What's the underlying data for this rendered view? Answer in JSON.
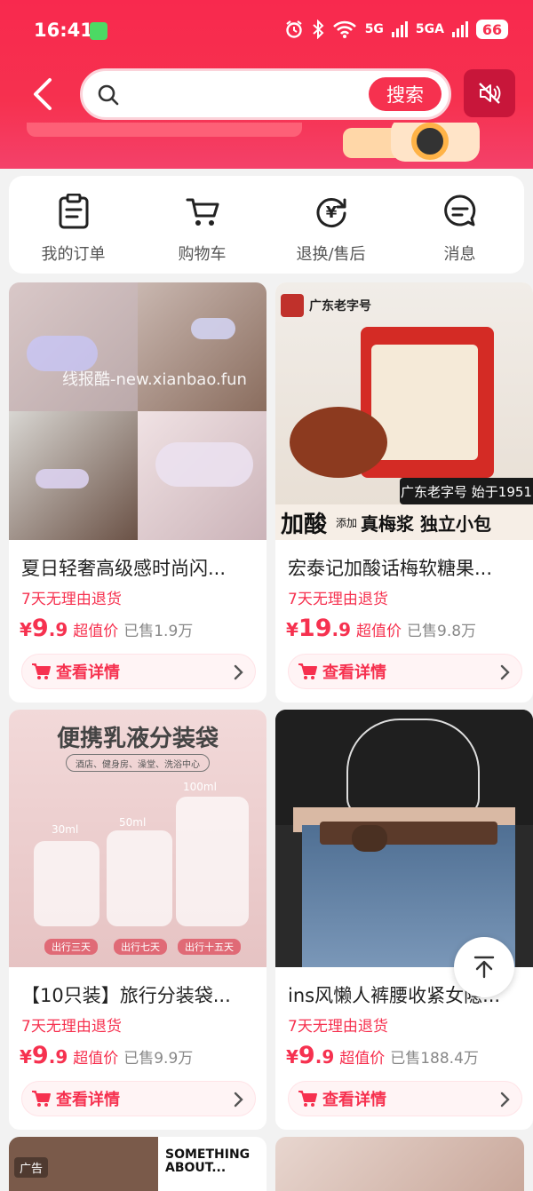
{
  "status": {
    "time": "16:41",
    "net1": "5G",
    "net2": "5GA",
    "battery": "66"
  },
  "search": {
    "button_label": "搜索",
    "value": ""
  },
  "quick_actions": [
    {
      "label": "我的订单",
      "icon": "order-icon"
    },
    {
      "label": "购物车",
      "icon": "cart-icon"
    },
    {
      "label": "退换/售后",
      "icon": "refund-icon"
    },
    {
      "label": "消息",
      "icon": "message-icon"
    }
  ],
  "watermark": "线报酷-new.xianbao.fun",
  "products": [
    {
      "title": "夏日轻奢高级感时尚闪...",
      "return": "7天无理由退货",
      "yen": "¥",
      "price_int": "9",
      "price_dec": ".9",
      "tag": "超值价",
      "sold": "已售1.9万",
      "detail": "查看详情"
    },
    {
      "title": "宏泰记加酸话梅软糖果...",
      "return": "7天无理由退货",
      "yen": "¥",
      "price_int": "19",
      "price_dec": ".9",
      "tag": "超值价",
      "sold": "已售9.8万",
      "detail": "查看详情",
      "image_text": {
        "brand": "广东老字号",
        "badge": "广东老字号 始于1951",
        "acid": "加酸",
        "add": "添加",
        "slogan": "真梅浆 独立小包"
      }
    },
    {
      "title": "【10只装】旅行分装袋...",
      "return": "7天无理由退货",
      "yen": "¥",
      "price_int": "9",
      "price_dec": ".9",
      "tag": "超值价",
      "sold": "已售9.9万",
      "detail": "查看详情",
      "image_text": {
        "headline": "便携乳液分装袋",
        "sub": "酒店、健身房、澡堂、洗浴中心",
        "s1": "30ml",
        "s2": "50ml",
        "s3": "100ml",
        "t1": "出行三天",
        "t2": "出行七天",
        "t3": "出行十五天"
      }
    },
    {
      "title": "ins风懒人裤腰收紧女隐...",
      "return": "7天无理由退货",
      "yen": "¥",
      "price_int": "9",
      "price_dec": ".9",
      "tag": "超值价",
      "sold": "已售188.4万",
      "detail": "查看详情"
    }
  ],
  "peek": {
    "ad": "广告",
    "text1": "SOMETHING",
    "text2": "ABOUT..."
  },
  "colors": {
    "brand": "#f6314f",
    "mute_bg": "#c8163a"
  }
}
